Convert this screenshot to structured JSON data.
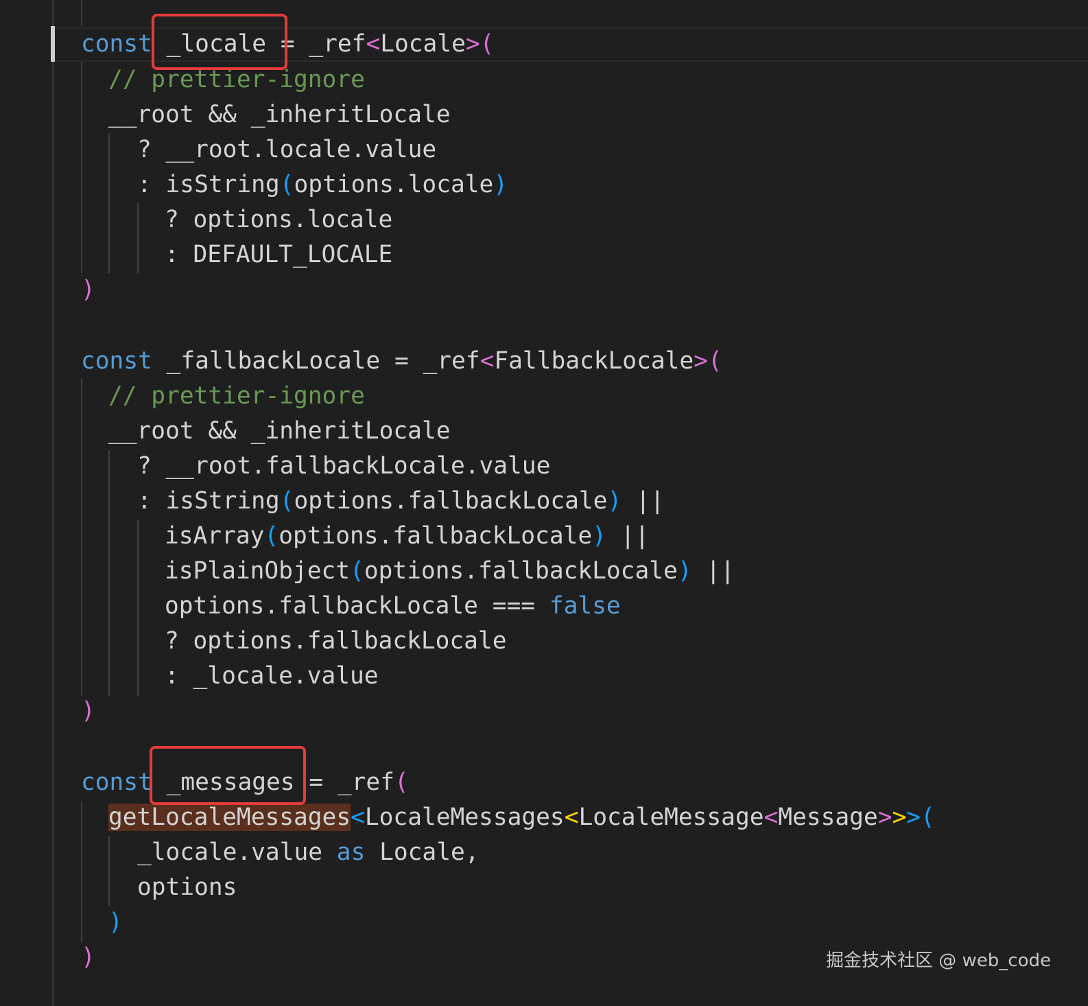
{
  "code": {
    "block1": {
      "l1": {
        "kw": "const",
        "sp": " ",
        "var": "_locale",
        "eq": " = _ref",
        "lt": "<",
        "type": "Locale",
        "gt": ">",
        "paren": "("
      },
      "l2": {
        "comment": "// prettier-ignore"
      },
      "l3": {
        "text": "__root && _inheritLocale"
      },
      "l4": {
        "text": "? __root.locale.value"
      },
      "l5": {
        "pre": ": isString",
        "po": "(",
        "mid": "options.locale",
        "pc": ")"
      },
      "l6": {
        "text": "? options.locale"
      },
      "l7": {
        "text": ": DEFAULT_LOCALE"
      },
      "l8": {
        "paren": ")"
      }
    },
    "block2": {
      "l1": {
        "kw": "const",
        "mid": " _fallbackLocale = _ref",
        "lt": "<",
        "type": "FallbackLocale",
        "gt": ">",
        "paren": "("
      },
      "l2": {
        "comment": "// prettier-ignore"
      },
      "l3": {
        "text": "__root && _inheritLocale"
      },
      "l4": {
        "text": "? __root.fallbackLocale.value"
      },
      "l5": {
        "pre": ": isString",
        "po": "(",
        "mid": "options.fallbackLocale",
        "pc": ")",
        "post": " ||"
      },
      "l6": {
        "pre": "isArray",
        "po": "(",
        "mid": "options.fallbackLocale",
        "pc": ")",
        "post": " ||"
      },
      "l7": {
        "pre": "isPlainObject",
        "po": "(",
        "mid": "options.fallbackLocale",
        "pc": ")",
        "post": " ||"
      },
      "l8": {
        "pre": "options.fallbackLocale === ",
        "kw": "false"
      },
      "l9": {
        "text": "? options.fallbackLocale"
      },
      "l10": {
        "text": ": _locale.value"
      },
      "l11": {
        "paren": ")"
      }
    },
    "block3": {
      "l1": {
        "kw": "const",
        "sp": " ",
        "var": "_messages",
        "eq": " = _ref",
        "paren": "("
      },
      "l2": {
        "fn": "getLocaleMessages",
        "lt1": "<",
        "t1": "LocaleMessages",
        "lt2": "<",
        "t2": "LocaleMessage",
        "lt3": "<",
        "t3": "Message",
        "gt3": ">",
        "gt2": ">",
        "gt1": ">",
        "paren": "("
      },
      "l3": {
        "pre": "_locale.value ",
        "kw": "as",
        "post": " Locale,"
      },
      "l4": {
        "text": "options"
      },
      "l5": {
        "paren": ")"
      },
      "l6": {
        "paren": ")"
      }
    }
  },
  "annotations": {
    "color": "#e53b3b",
    "boxes": [
      "_locale",
      "_messages"
    ]
  },
  "theme": {
    "background": "#1f1f1f",
    "text": "#d4d4d4",
    "keyword": "#569cd6",
    "comment": "#6a9955",
    "bracket_level1": "#da70d6",
    "bracket_level2": "#179fff",
    "bracket_level3": "#ffd700"
  },
  "watermark": "掘金技术社区 @ web_code"
}
